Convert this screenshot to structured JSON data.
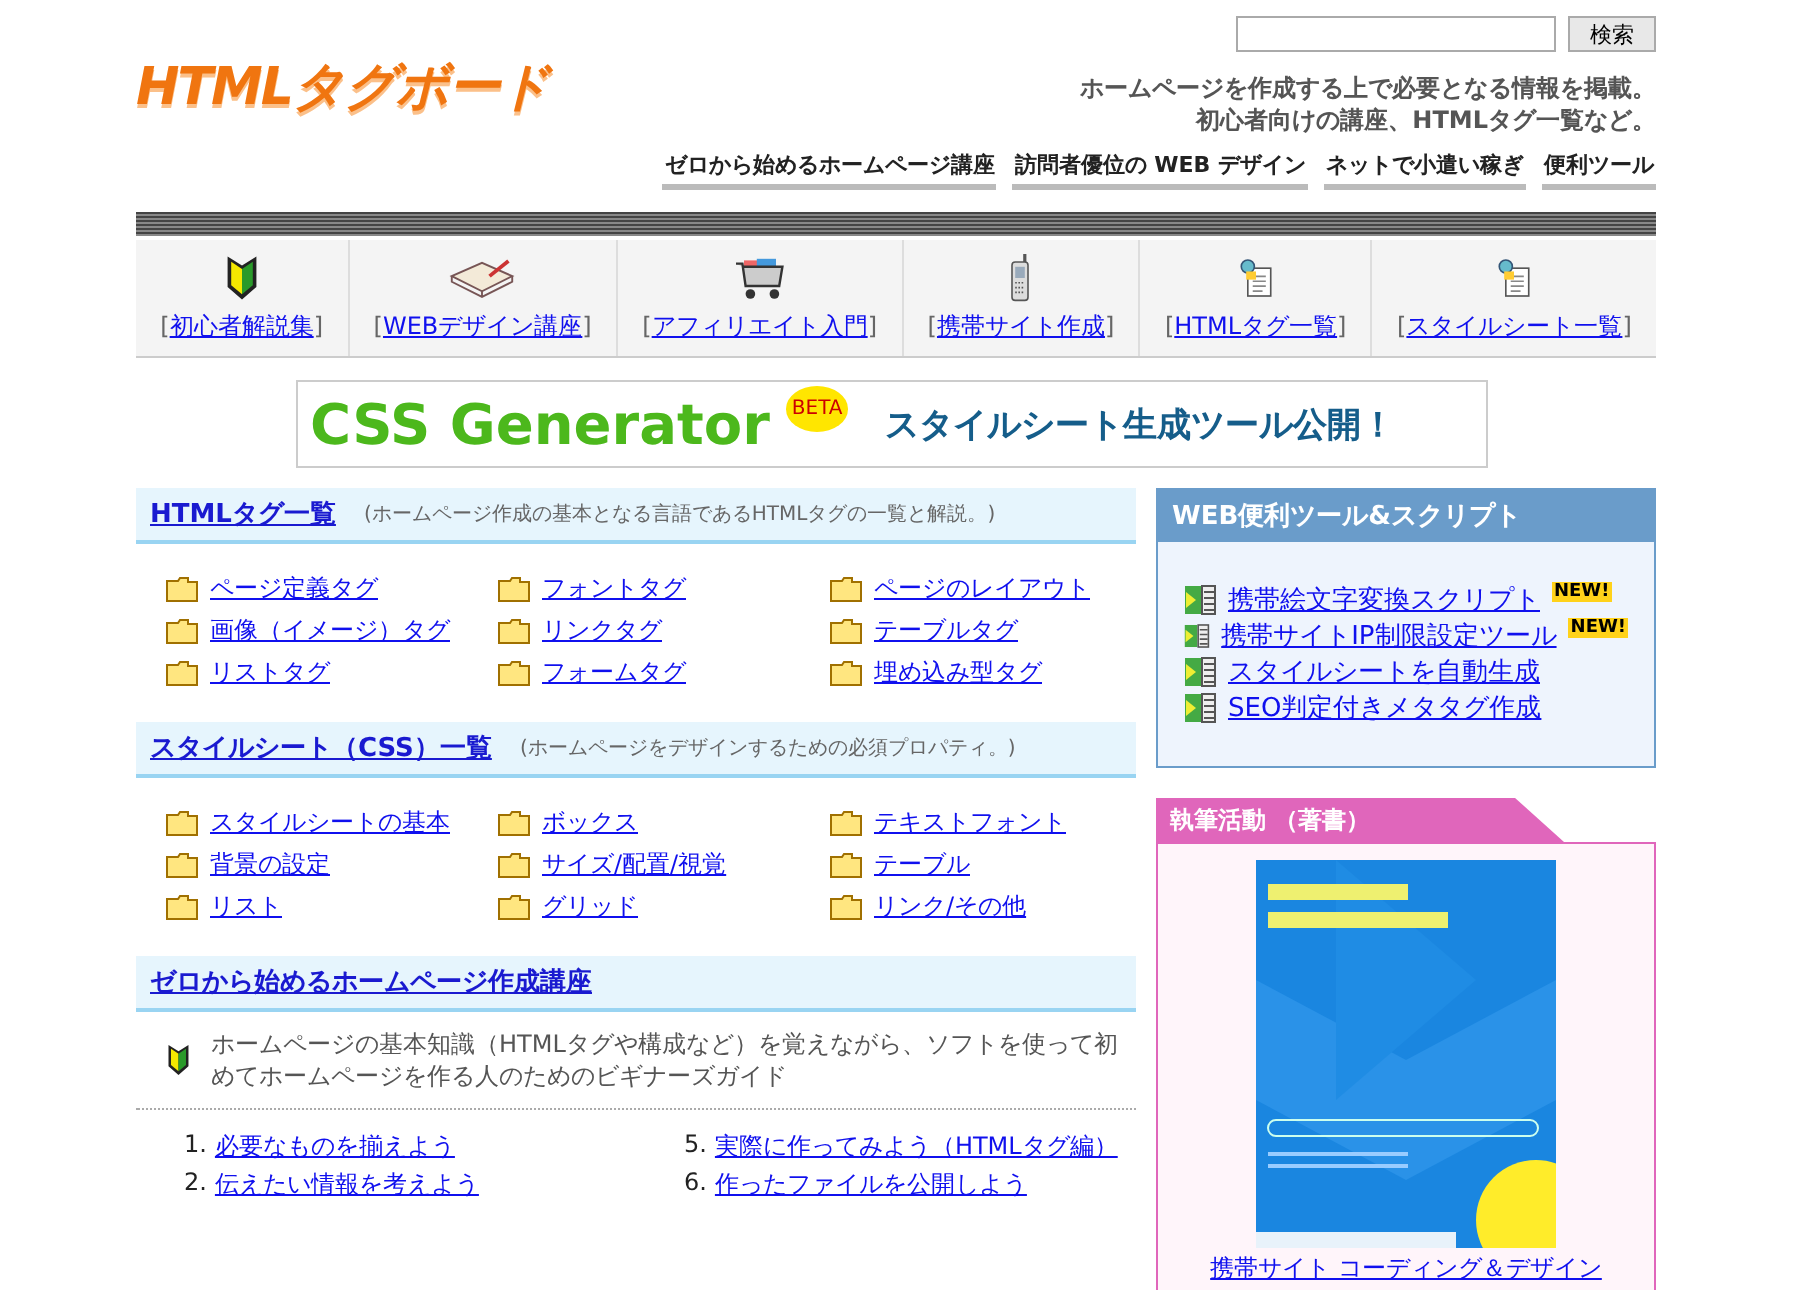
{
  "header": {
    "logo": "HTMLタグボード",
    "search": {
      "button": "検索"
    },
    "tagline": [
      "ホームページを作成する上で必要となる情報を掲載。",
      "初心者向けの講座、HTMLタグ一覧など。"
    ],
    "nav": [
      "ゼロから始めるホームページ講座",
      "訪問者優位の WEB デザイン",
      "ネットで小遣い稼ぎ",
      "便利ツール"
    ]
  },
  "icon_nav": [
    {
      "kind": "beginner",
      "label": "初心者解説集",
      "brackets": [
        "[",
        "]"
      ]
    },
    {
      "kind": "book",
      "label": "WEBデザイン講座",
      "brackets": [
        "[",
        "]"
      ]
    },
    {
      "kind": "cart",
      "label": "アフィリエイト入門",
      "brackets": [
        "[",
        "]"
      ]
    },
    {
      "kind": "phone",
      "label": "携帯サイト作成",
      "brackets": [
        "[",
        "]"
      ]
    },
    {
      "kind": "tag",
      "label": "HTMLタグ一覧",
      "brackets": [
        "[",
        "]"
      ]
    },
    {
      "kind": "tag",
      "label": "スタイルシート一覧",
      "brackets": [
        "[",
        "]"
      ]
    }
  ],
  "banner": {
    "title": "CSS Generator",
    "badge": "BETA",
    "text": "スタイルシート生成ツール公開！"
  },
  "sections": [
    {
      "title": "HTMLタグ一覧",
      "note": "(ホームページ作成の基本となる言語であるHTMLタグの一覧と解説。)",
      "items": [
        "ページ定義タグ",
        "フォントタグ",
        "ページのレイアウト",
        "画像（イメージ）タグ",
        "リンクタグ",
        "テーブルタグ",
        "リストタグ",
        "フォームタグ",
        "埋め込み型タグ"
      ]
    },
    {
      "title": "スタイルシート（CSS）一覧",
      "note": "(ホームページをデザインするための必須プロパティ。)",
      "items": [
        "スタイルシートの基本",
        "ボックス",
        "テキストフォント",
        "背景の設定",
        "サイズ/配置/視覚",
        "テーブル",
        "リスト",
        "グリッド",
        "リンク/その他"
      ]
    }
  ],
  "course": {
    "title": "ゼロから始めるホームページ作成講座",
    "description": "ホームページの基本知識（HTMLタグや構成など）を覚えながら、ソフトを使って初めてホームページを作る人のためのビギナーズガイド",
    "steps": [
      {
        "number": "1.",
        "label": "必要なものを揃えよう"
      },
      {
        "number": "5.",
        "label": "実際に作ってみよう（HTMLタグ編）"
      },
      {
        "number": "2.",
        "label": "伝えたい情報を考えよう"
      },
      {
        "number": "6.",
        "label": "作ったファイルを公開しよう"
      }
    ]
  },
  "tools": {
    "title": "WEB便利ツール&スクリプト",
    "items": [
      {
        "label": "携帯絵文字変換スクリプト",
        "badge": "NEW!"
      },
      {
        "label": "携帯サイトIP制限設定ツール",
        "badge": "NEW!"
      },
      {
        "label": "スタイルシートを自動生成"
      },
      {
        "label": "SEO判定付きメタタグ作成"
      }
    ]
  },
  "book": {
    "title": "執筆活動 （著書）",
    "link": "携帯サイト コーディング＆デザイン"
  }
}
